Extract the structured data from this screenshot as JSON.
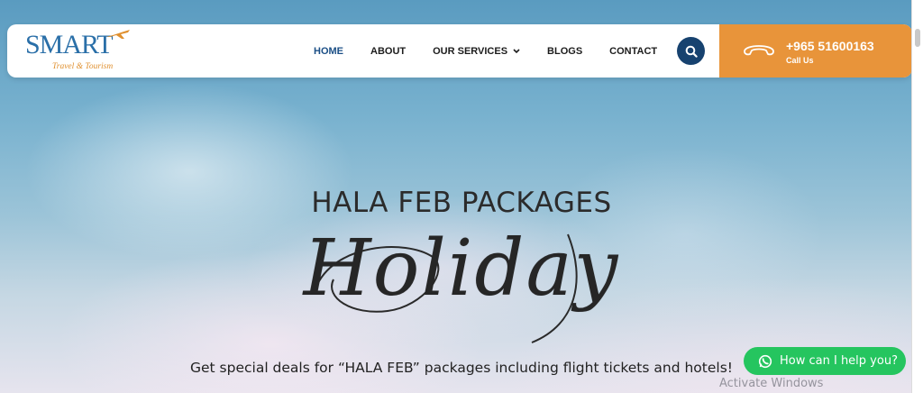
{
  "logo": {
    "main": "SMART",
    "sub": "Travel & Tourism"
  },
  "nav": {
    "items": [
      {
        "label": "HOME"
      },
      {
        "label": "ABOUT"
      },
      {
        "label": "OUR SERVICES"
      },
      {
        "label": "BLOGS"
      },
      {
        "label": "CONTACT"
      }
    ],
    "active": "HOME"
  },
  "call": {
    "number": "+965 51600163",
    "label": "Call Us"
  },
  "hero": {
    "title": "HALA FEB PACKAGES",
    "script": "Holiday",
    "tagline": "Get special deals for “HALA FEB” packages including flight tickets and hotels!"
  },
  "whatsapp": {
    "label": "How can I help you?"
  },
  "watermark": "Activate Windows",
  "colors": {
    "brand_blue": "#17426f",
    "accent_orange": "#e8943a",
    "whatsapp_green": "#25c55f"
  },
  "icons": {
    "search": "search-icon",
    "phone": "phone-icon",
    "dropdown": "chevron-down-icon",
    "whatsapp": "whatsapp-icon",
    "plane": "plane-icon"
  }
}
